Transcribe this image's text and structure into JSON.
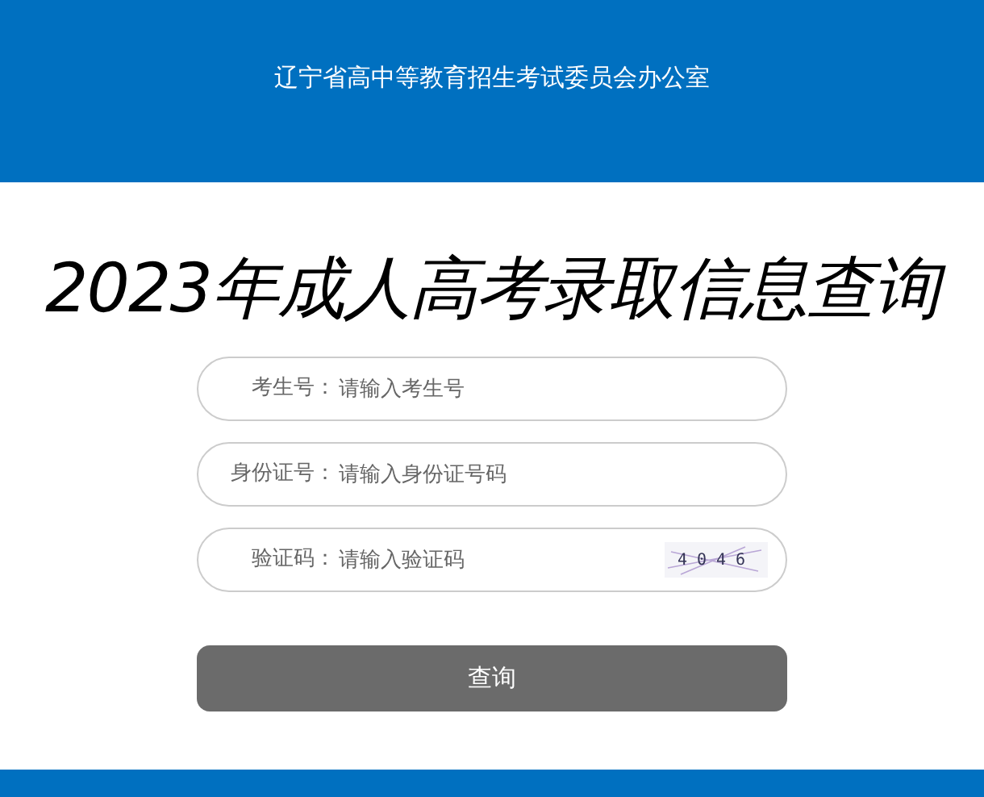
{
  "header": {
    "title": "辽宁省高中等教育招生考试委员会办公室"
  },
  "heading": "2023年成人高考录取信息查询",
  "fields": [
    {
      "kind": "text",
      "label": "考生号：",
      "placeholder": "请输入考生号"
    },
    {
      "kind": "text",
      "label": "身份证号：",
      "placeholder": "请输入身份证号码"
    },
    {
      "kind": "captcha",
      "label": "验证码：",
      "placeholder": "请输入验证码",
      "captcha": "4046"
    }
  ],
  "submit": "查询"
}
